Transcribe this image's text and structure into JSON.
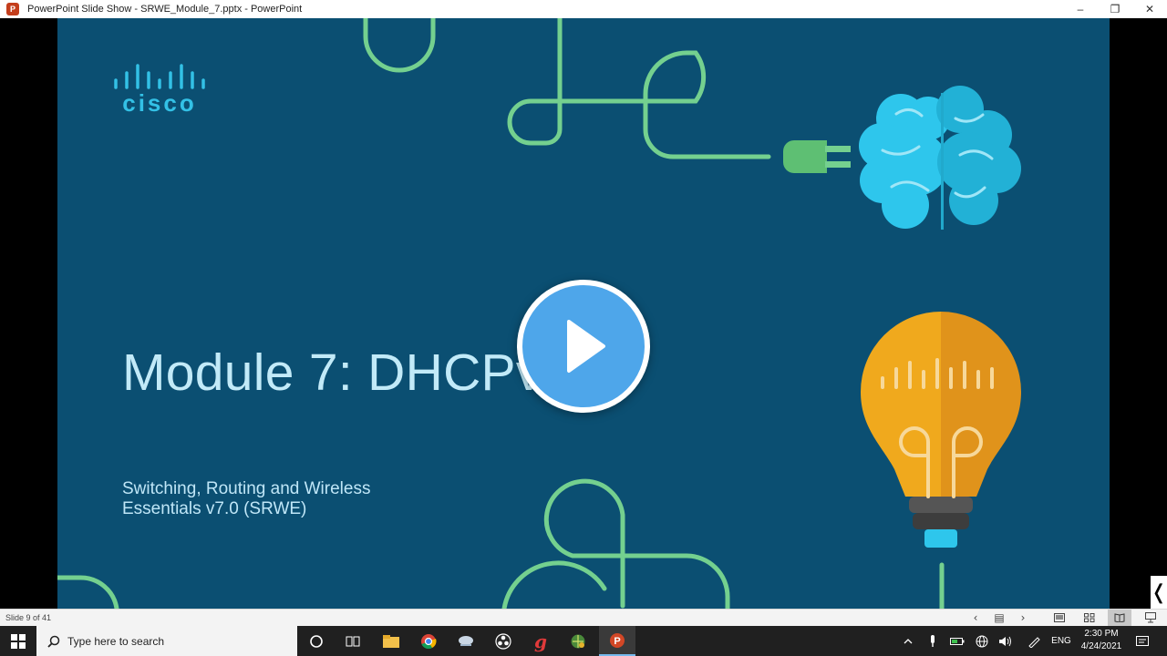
{
  "window": {
    "title": "PowerPoint Slide Show  -  SRWE_Module_7.pptx - PowerPoint",
    "app_icon_letter": "P",
    "controls": {
      "minimize": "–",
      "restore": "❐",
      "close": "✕"
    }
  },
  "slide": {
    "logo_text": "cisco",
    "title": "Module 7: DHCPv4",
    "subtitle_line1": "Switching, Routing and Wireless",
    "subtitle_line2": "Essentials v7.0 (SRWE)",
    "background_color": "#0b4f72",
    "side_tab_glyph": "❬"
  },
  "video_overlay": {
    "play_icon": "play-icon",
    "color": "#4ea6ea"
  },
  "status_bar": {
    "slide_count": "Slide 9 of 41",
    "prev_glyph": "‹",
    "menu_glyph": "▤",
    "next_glyph": "›",
    "views": [
      "normal-view-icon",
      "slide-sorter-icon",
      "reading-view-icon",
      "slideshow-icon"
    ]
  },
  "taskbar": {
    "search_placeholder": "Type here to search",
    "apps": [
      "cortana-icon",
      "task-view-icon",
      "file-explorer-icon",
      "chrome-icon",
      "network-app-icon",
      "obs-icon",
      "app-g-icon",
      "app-globe-icon",
      "powerpoint-icon"
    ],
    "tray": {
      "language": "ENG"
    },
    "clock_time": "2:30 PM",
    "clock_date": "4/24/2021"
  }
}
